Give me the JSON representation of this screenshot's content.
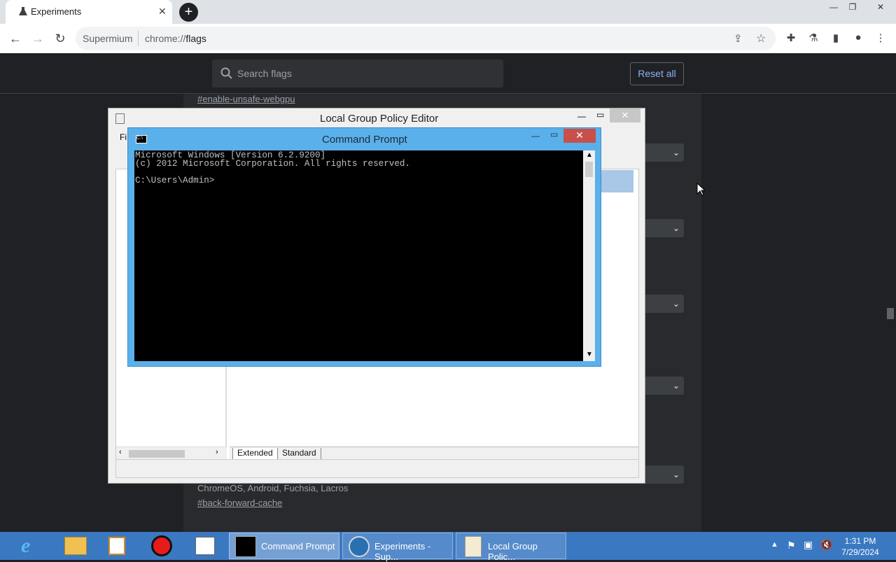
{
  "browser": {
    "tab_title": "Experiments",
    "omnibox_host": "Supermium",
    "omnibox_url_prefix": "chrome://",
    "omnibox_url_path": "flags"
  },
  "flags_page": {
    "search_placeholder": "Search flags",
    "reset_all_label": "Reset all",
    "top_flag": "#enable-unsafe-webgpu",
    "bottom_platforms": "ChromeOS, Android, Fuchsia, Lacros",
    "bottom_flag": "#back-forward-cache"
  },
  "gpe": {
    "title": "Local Group Policy Editor",
    "menu_partial": "Fi",
    "tab_extended": "Extended",
    "tab_standard": "Standard"
  },
  "cmd": {
    "title": "Command Prompt",
    "line1": "Microsoft Windows [Version 6.2.9200]",
    "line2": "(c) 2012 Microsoft Corporation. All rights reserved.",
    "line3": "",
    "line4": "C:\\Users\\Admin>"
  },
  "taskbar": {
    "items": [
      {
        "label": "Command Prompt"
      },
      {
        "label": "Experiments - Sup..."
      },
      {
        "label": "Local Group Polic..."
      }
    ],
    "time": "1:31 PM",
    "date": "7/29/2024"
  }
}
